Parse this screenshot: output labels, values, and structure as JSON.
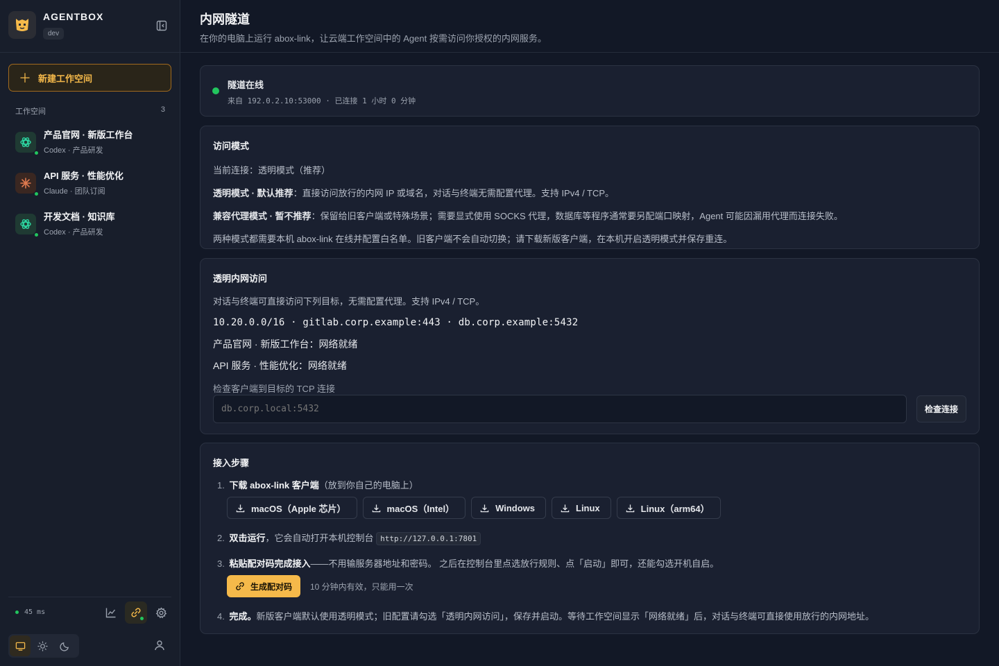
{
  "brand": {
    "name": "AGENTBOX",
    "env": "dev"
  },
  "sidebar": {
    "new_workspace_label": "新建工作空间",
    "workspaces_header": "工作空间",
    "workspaces_count": "3",
    "workspaces": [
      {
        "name": "产品官网 · 新版工作台",
        "meta": "Codex · 产品研发",
        "icon": "openai-icon"
      },
      {
        "name": "API 服务 · 性能优化",
        "meta": "Claude · 团队订阅",
        "icon": "claude-icon"
      },
      {
        "name": "开发文档 · 知识库",
        "meta": "Codex · 产品研发",
        "icon": "openai-icon"
      }
    ],
    "latency": "45 ms"
  },
  "page": {
    "title": "内网隧道",
    "subtitle": "在你的电脑上运行 abox-link，让云端工作空间中的 Agent 按需访问你授权的内网服务。"
  },
  "status": {
    "title": "隧道在线",
    "detail": "来自 192.0.2.10:53000 · 已连接 1 小时 0 分钟",
    "color": "#22c55e"
  },
  "mode": {
    "title": "访问模式",
    "current_prefix": "当前连接：",
    "current_value": "透明模式（推荐）",
    "transparent_label": "透明模式 · 默认推荐",
    "transparent_desc": "：直接访问放行的内网 IP 或域名，对话与终端无需配置代理。支持 IPv4 / TCP。",
    "compat_label": "兼容代理模式 · 暂不推荐",
    "compat_desc": "：保留给旧客户端或特殊场景；需要显式使用 SOCKS 代理，数据库等程序通常要另配端口映射，Agent 可能因漏用代理而连接失败。",
    "note": "两种模式都需要本机 abox-link 在线并配置白名单。旧客户端不会自动切换；请下载新版客户端，在本机开启透明模式并保存重连。"
  },
  "transparent": {
    "title": "透明内网访问",
    "desc": "对话与终端可直接访问下列目标，无需配置代理。支持 IPv4 / TCP。",
    "targets": "10.20.0.0/16 · gitlab.corp.example:443 · db.corp.example:5432",
    "workspace_statuses": [
      "产品官网 · 新版工作台：网络就绪",
      "API 服务 · 性能优化：网络就绪"
    ],
    "check_label": "检查客户端到目标的 TCP 连接",
    "check_placeholder": "db.corp.local:5432",
    "check_button": "检查连接"
  },
  "steps": {
    "title": "接入步骤",
    "step1_num": "1.",
    "step1_bold": "下载 abox-link 客户端",
    "step1_rest": "（放到你自己的电脑上）",
    "downloads": [
      "macOS（Apple 芯片）",
      "macOS（Intel）",
      "Windows",
      "Linux",
      "Linux（arm64）"
    ],
    "step2_num": "2.",
    "step2_bold": "双击运行",
    "step2_rest": "，它会自动打开本机控制台",
    "step2_url": "http://127.0.0.1:7801",
    "step3_num": "3.",
    "step3_bold": "粘贴配对码完成接入",
    "step3_rest": "——不用输服务器地址和密码。 之后在控制台里点选放行规则、点「启动」即可，还能勾选开机自启。",
    "generate_button": "生成配对码",
    "generate_note": "10 分钟内有效，只能用一次",
    "step4_num": "4.",
    "step4_bold": "完成。",
    "step4_rest": "新版客户端默认使用透明模式；旧配置请勾选「透明内网访问」，保存并启动。等待工作空间显示「网络就绪」后，对话与终端可直接使用放行的内网地址。"
  },
  "colors": {
    "accent": "#f5b94a",
    "online": "#22c55e",
    "background": "#121826"
  }
}
